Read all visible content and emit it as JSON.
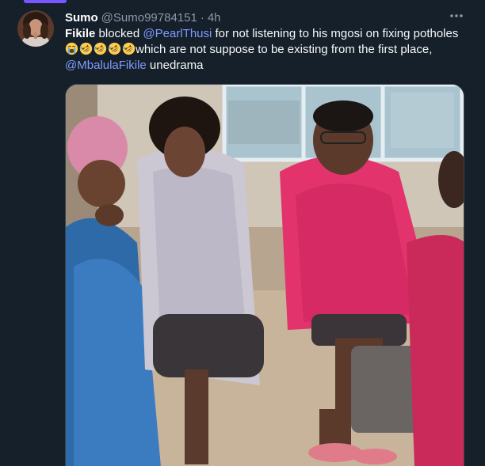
{
  "tweet": {
    "display_name": "Sumo",
    "handle": "@Sumo99784151",
    "separator": "·",
    "time": "4h",
    "text": {
      "part1_name": "Fikile",
      "part2": " blocked ",
      "mention1": "@PearlThusi",
      "part3": " for not listening to his mgosi on fixing potholes ",
      "part4": "which are not suppose to be existing from the first place, ",
      "mention2": "@MbalulaFikile",
      "part5": " unedrama"
    },
    "emojis": [
      "loudly-crying-face",
      "rolling-on-floor-laughing",
      "rolling-on-floor-laughing",
      "rolling-on-floor-laughing",
      "rolling-on-floor-laughing"
    ]
  },
  "colors": {
    "background": "#15202b",
    "accent": "#7856ff",
    "mention": "#7f9bff",
    "muted": "#8b98a5"
  },
  "icons": {
    "more": "more-horizontal-icon"
  }
}
